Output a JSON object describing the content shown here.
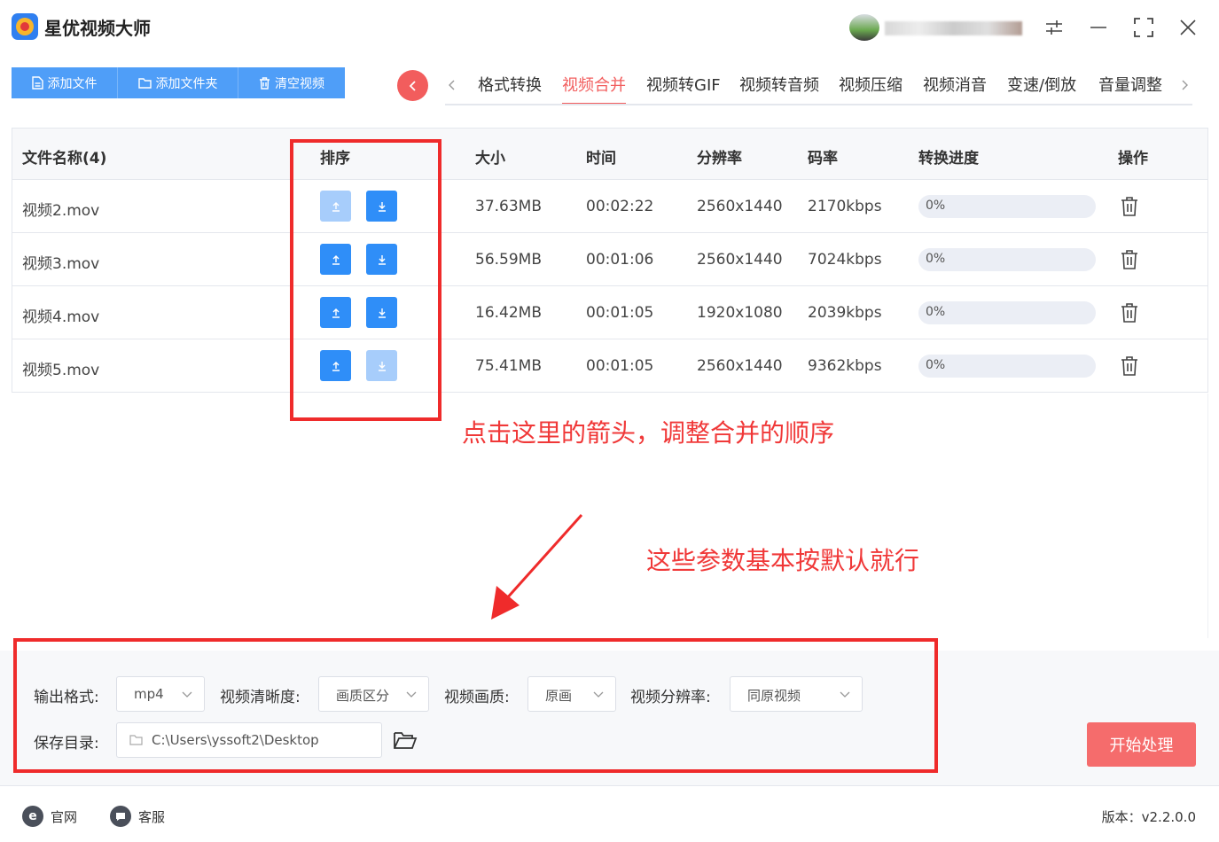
{
  "app": {
    "title": "星优视频大师"
  },
  "toolbar": {
    "add_file": "添加文件",
    "add_folder": "添加文件夹",
    "clear": "清空视频"
  },
  "tabs": [
    "格式转换",
    "视频合并",
    "视频转GIF",
    "视频转音频",
    "视频压缩",
    "视频消音",
    "变速/倒放",
    "音量调整"
  ],
  "active_tab": "视频合并",
  "table": {
    "headers": {
      "name": "文件名称(4)",
      "sort": "排序",
      "size": "大小",
      "time": "时间",
      "resolution": "分辨率",
      "bitrate": "码率",
      "progress": "转换进度",
      "action": "操作"
    },
    "rows": [
      {
        "name": "视频2.mov",
        "size": "37.63MB",
        "time": "00:02:22",
        "resolution": "2560x1440",
        "bitrate": "2170kbps",
        "progress": "0%",
        "up_enabled": false,
        "down_enabled": true
      },
      {
        "name": "视频3.mov",
        "size": "56.59MB",
        "time": "00:01:06",
        "resolution": "2560x1440",
        "bitrate": "7024kbps",
        "progress": "0%",
        "up_enabled": true,
        "down_enabled": true
      },
      {
        "name": "视频4.mov",
        "size": "16.42MB",
        "time": "00:01:05",
        "resolution": "1920x1080",
        "bitrate": "2039kbps",
        "progress": "0%",
        "up_enabled": true,
        "down_enabled": true
      },
      {
        "name": "视频5.mov",
        "size": "75.41MB",
        "time": "00:01:05",
        "resolution": "2560x1440",
        "bitrate": "9362kbps",
        "progress": "0%",
        "up_enabled": true,
        "down_enabled": false
      }
    ]
  },
  "annotations": {
    "sort_hint": "点击这里的箭头，调整合并的顺序",
    "params_hint": "这些参数基本按默认就行"
  },
  "settings": {
    "format_label": "输出格式:",
    "format_value": "mp4",
    "clarity_label": "视频清晰度:",
    "clarity_value": "画质区分",
    "quality_label": "视频画质:",
    "quality_value": "原画",
    "resolution_label": "视频分辨率:",
    "resolution_value": "同原视频",
    "save_label": "保存目录:",
    "save_path": "C:\\Users\\yssoft2\\Desktop",
    "start_button": "开始处理"
  },
  "footer": {
    "website": "官网",
    "support": "客服",
    "version": "版本：v2.2.0.0"
  },
  "colors": {
    "primary_blue": "#2f8ef8",
    "toolbar_blue": "#4f9ef8",
    "accent_red": "#f25d5d",
    "annotation_red": "#ef2b2b"
  }
}
